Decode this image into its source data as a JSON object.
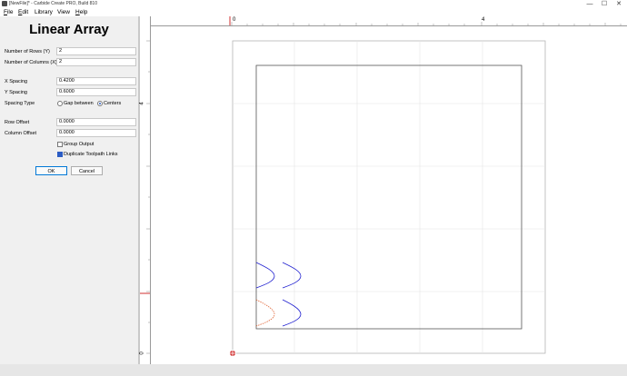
{
  "window": {
    "title": "[NewFile]* - Carbide Create PRO, Build 810",
    "controls": {
      "minimize": "—",
      "maximize": "☐",
      "close": "✕"
    },
    "app_icon": "app-icon"
  },
  "menu": {
    "items": [
      {
        "id": "file",
        "first": "F",
        "rest": "ile"
      },
      {
        "id": "edit",
        "first": "E",
        "rest": "dit"
      },
      {
        "id": "library",
        "first": "",
        "rest": "Library"
      },
      {
        "id": "view",
        "first": "",
        "rest": "View"
      },
      {
        "id": "help",
        "first": "H",
        "rest": "elp"
      }
    ]
  },
  "panel": {
    "title": "Linear Array",
    "rows_label": "Number of Rows (Y)",
    "rows_value": "2",
    "cols_label": "Number of Columns (X)",
    "cols_value": "2",
    "xspacing_label": "X Spacing",
    "xspacing_value": "0.4200",
    "yspacing_label": "Y Spacing",
    "yspacing_value": "0.6000",
    "spacing_type_label": "Spacing Type",
    "spacing_options": [
      "Gap between",
      "Centers"
    ],
    "spacing_selected": "Centers",
    "row_offset_label": "Row Offset",
    "row_offset_value": "0.0000",
    "col_offset_label": "Column Offset",
    "col_offset_value": "0.0000",
    "group_output_label": "Group Output",
    "group_output_checked": false,
    "dup_links_label": "Duplicate Toolpath Links",
    "dup_links_checked": true,
    "ok_label": "OK",
    "cancel_label": "Cancel"
  },
  "rulers": {
    "h_labels": [
      "0",
      "4"
    ],
    "v_labels": [
      "4",
      "0"
    ]
  },
  "colors": {
    "accent": "#2b5cc4",
    "selected_vector": "#e06030",
    "array_vector": "#2020d0",
    "ruler_marker": "#d03030"
  }
}
